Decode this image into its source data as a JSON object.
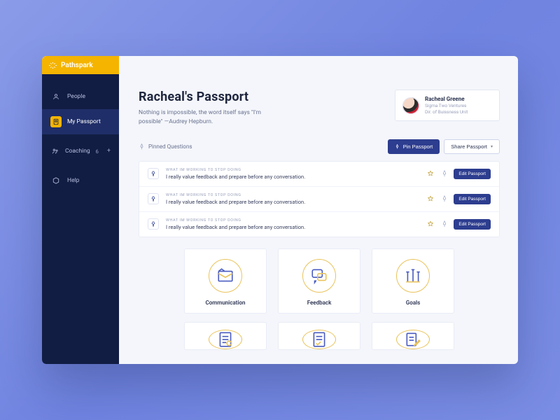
{
  "brand": {
    "name": "Pathspark"
  },
  "sidebar": {
    "items": [
      {
        "label": "People"
      },
      {
        "label": "My Passport"
      },
      {
        "label": "Coaching",
        "badge": "6"
      },
      {
        "label": "Help"
      }
    ]
  },
  "header": {
    "title": "Racheal's Passport",
    "subtitle": "Nothing is impossible, the word itself says \"I'm possible\" —Audrey Hepburn."
  },
  "profile": {
    "name": "Racheal Greene",
    "line1": "Sigma Two Ventures",
    "line2": "Dir. of Buissness Unit"
  },
  "toolbar": {
    "pinned_label": "Pinned Questions",
    "pin_button": "Pin Passport",
    "share_button": "Share Passport"
  },
  "questions": [
    {
      "kicker": "WHAT IM WORKING TO STOP DOING",
      "body": "I really value feedback and prepare before any conversation.",
      "edit": "Edit Passport"
    },
    {
      "kicker": "WHAT IM WORKING TO STOP DOING",
      "body": "I really value feedback and prepare before any conversation.",
      "edit": "Edit Passport"
    },
    {
      "kicker": "WHAT IM WORKING TO STOP DOING",
      "body": "I really value feedback and prepare before any conversation.",
      "edit": "Edit Passport"
    }
  ],
  "categories": [
    {
      "label": "Communication"
    },
    {
      "label": "Feedback"
    },
    {
      "label": "Goals"
    }
  ]
}
